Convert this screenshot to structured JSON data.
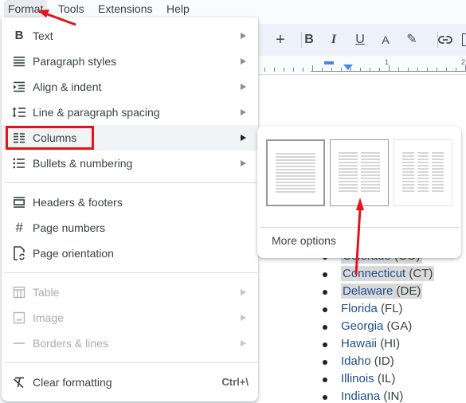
{
  "menubar": {
    "items": [
      {
        "label": "Format",
        "active": true
      },
      {
        "label": "Tools"
      },
      {
        "label": "Extensions"
      },
      {
        "label": "Help"
      }
    ]
  },
  "toolbar": {
    "zoom_fragment": "2",
    "buttons": [
      {
        "name": "increase-font-size",
        "glyph": "+"
      },
      {
        "name": "bold",
        "glyph": "B"
      },
      {
        "name": "italic",
        "glyph": "I"
      },
      {
        "name": "underline",
        "glyph": "U"
      },
      {
        "name": "text-color",
        "glyph": "A"
      },
      {
        "name": "highlight-color",
        "glyph": "✎"
      },
      {
        "name": "insert-link",
        "glyph": "⊖"
      }
    ]
  },
  "ruler": {
    "labels": [
      "1",
      "2"
    ]
  },
  "format_menu": {
    "items": [
      {
        "label": "Text",
        "icon": "bold-b-icon",
        "submenu": true
      },
      {
        "label": "Paragraph styles",
        "icon": "paragraph-lines-icon",
        "submenu": true
      },
      {
        "label": "Align & indent",
        "icon": "indent-icon",
        "submenu": true
      },
      {
        "label": "Line & paragraph spacing",
        "icon": "line-spacing-icon",
        "submenu": true
      },
      {
        "label": "Columns",
        "icon": "columns-icon",
        "submenu": true,
        "highlighted": true
      },
      {
        "label": "Bullets & numbering",
        "icon": "bulleted-list-icon",
        "submenu": true
      },
      {
        "label": "Headers & footers",
        "icon": "header-footer-icon"
      },
      {
        "label": "Page numbers",
        "icon": "hash-icon"
      },
      {
        "label": "Page orientation",
        "icon": "page-orientation-icon"
      },
      {
        "label": "Table",
        "icon": "table-icon",
        "submenu": true,
        "disabled": true
      },
      {
        "label": "Image",
        "icon": "image-icon",
        "submenu": true,
        "disabled": true
      },
      {
        "label": "Borders & lines",
        "icon": "border-line-icon",
        "submenu": true,
        "disabled": true
      },
      {
        "label": "Clear formatting",
        "icon": "clear-formatting-icon",
        "shortcut": "Ctrl+\\"
      }
    ]
  },
  "columns_submenu": {
    "presets": [
      {
        "name": "one-column",
        "columns": 1,
        "selected": true
      },
      {
        "name": "two-columns",
        "columns": 2
      },
      {
        "name": "three-columns",
        "columns": 3
      }
    ],
    "more_options": "More options"
  },
  "document": {
    "list": [
      {
        "name": "Colorado",
        "abbr": "(CO)",
        "highlighted": true
      },
      {
        "name": "Connecticut",
        "abbr": "(CT)",
        "highlighted": true
      },
      {
        "name": "Delaware",
        "abbr": "(DE)",
        "highlighted": true
      },
      {
        "name": "Florida",
        "abbr": "(FL)"
      },
      {
        "name": "Georgia",
        "abbr": "(GA)"
      },
      {
        "name": "Hawaii",
        "abbr": "(HI)"
      },
      {
        "name": "Idaho",
        "abbr": "(ID)"
      },
      {
        "name": "Illinois",
        "abbr": "(IL)"
      },
      {
        "name": "Indiana",
        "abbr": "(IN)"
      }
    ]
  },
  "colors": {
    "annotation_red": "#e5141b",
    "link_text": "#1f4e8c",
    "ruler_accent": "#4285f4"
  }
}
